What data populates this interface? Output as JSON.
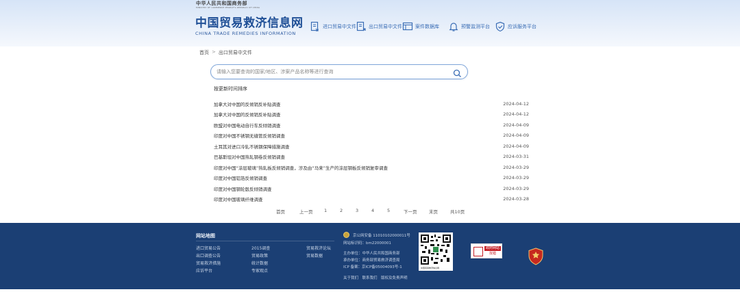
{
  "header": {
    "ministry_cn": "中华人民共和国商务部",
    "ministry_en": "MINISTRY OF COMMERCE PEOPLE'S REPUBLIC OF CHINA",
    "logo_cn": "中国贸易救济信息网",
    "logo_en": "CHINA TRADE REMEDIES INFORMATION"
  },
  "nav": {
    "items": [
      {
        "label": "进口贸易中文件",
        "icon": "import-document-icon"
      },
      {
        "label": "出口贸易中文件",
        "icon": "export-document-icon"
      },
      {
        "label": "案件数据库",
        "icon": "case-database-icon"
      },
      {
        "label": "预警监测平台",
        "icon": "bell-icon"
      },
      {
        "label": "应诉服务平台",
        "icon": "shield-icon"
      }
    ]
  },
  "breadcrumb": {
    "home": "首页",
    "separator": ">",
    "current": "出口贸易中文件"
  },
  "search": {
    "placeholder": "请输入您要查询的国家/地区、涉案产品名称等进行查询",
    "value": ""
  },
  "section": {
    "title": "按更新时间排序"
  },
  "list": [
    {
      "title": "加拿大对中国的反倾销反补贴调查",
      "date": "2024-04-12"
    },
    {
      "title": "加拿大对中国的反倾销反补贴调查",
      "date": "2024-04-12"
    },
    {
      "title": "欧盟对中国电动自行车反倾销调查",
      "date": "2024-04-09"
    },
    {
      "title": "印度对中国不锈钢无缝管反倾销调查",
      "date": "2024-04-09"
    },
    {
      "title": "土耳其对进口冷轧不锈钢保障措施调查",
      "date": "2024-04-09"
    },
    {
      "title": "巴基斯坦对中国热轧钢卷反倾销调查",
      "date": "2024-03-31"
    },
    {
      "title": "印度对中国“涂层玻璃”热轧板反倾销调查，涉及由“马来”生产的涂层钢板反倾销复审调查",
      "date": "2024-03-29"
    },
    {
      "title": "印度对中国铝箔反倾销调查",
      "date": "2024-03-29"
    },
    {
      "title": "印度对中国钢轮毂反倾销调查",
      "date": "2024-03-29"
    },
    {
      "title": "印度对中国玻璃纤维调查",
      "date": "2024-03-28"
    }
  ],
  "pagination": {
    "first": "首页",
    "prev": "上一页",
    "pages": [
      "1",
      "2",
      "3",
      "4",
      "5"
    ],
    "next": "下一页",
    "last": "末页",
    "total": "共10页"
  },
  "footer": {
    "title": "网站地图",
    "links_col1": [
      "进口贸易公告",
      "出口调查公告",
      "贸易救济措施",
      "应诉平台"
    ],
    "links_col2": [
      "2015调查",
      "贸易政策",
      "统计数据",
      "专家观点"
    ],
    "links_col3": [
      "贸易救济论坛",
      "贸易数据"
    ],
    "record_1": "京公网安备 11010102000011号",
    "record_2": "网站标识码：bm22000001",
    "sponsor": "主办单位：中华人民共和国商务部",
    "organizer": "承办单位：商务部贸易救济调查局",
    "icp": "ICP 备案：京ICP备05004093号-1",
    "bottom_links": "关于我们　联系我们　版权及免责声明",
    "qr_caption": "中国贸易救济信息网",
    "gov_badge_top": "政府网站",
    "gov_badge_bottom": "找错"
  },
  "colors": {
    "brand": "#1f4f96",
    "nav_text": "#3a6db5",
    "footer_bg": "#1b3f74",
    "search_border": "#7fa6d9"
  }
}
